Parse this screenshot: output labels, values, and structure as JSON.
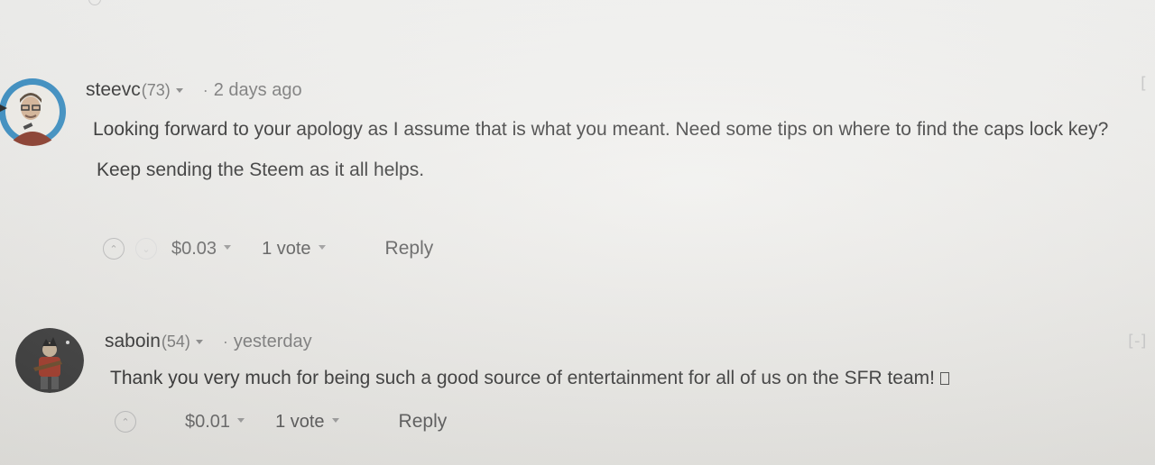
{
  "comments": [
    {
      "author": "steevc",
      "reputation": "(73)",
      "separator": "·",
      "time": "2 days ago",
      "paragraphs": [
        "Looking forward to your apology as I assume that is what you meant. Need some tips on where to find the caps lock key?",
        "Keep sending the Steem as it all helps."
      ],
      "payout": "$0.03",
      "votes": "1 vote",
      "reply_label": "Reply",
      "collapse_label": "[",
      "avatar_ring_color": "#3a8fc4"
    },
    {
      "author": "saboin",
      "reputation": "(54)",
      "separator": "·",
      "time": "yesterday",
      "text": "Thank you very much for being such a good source of entertainment for all of us on the SFR team!",
      "payout": "$0.01",
      "votes": "1 vote",
      "reply_label": "Reply",
      "collapse_label": "[-]",
      "avatar_bg_color": "#3b3b3b"
    }
  ]
}
